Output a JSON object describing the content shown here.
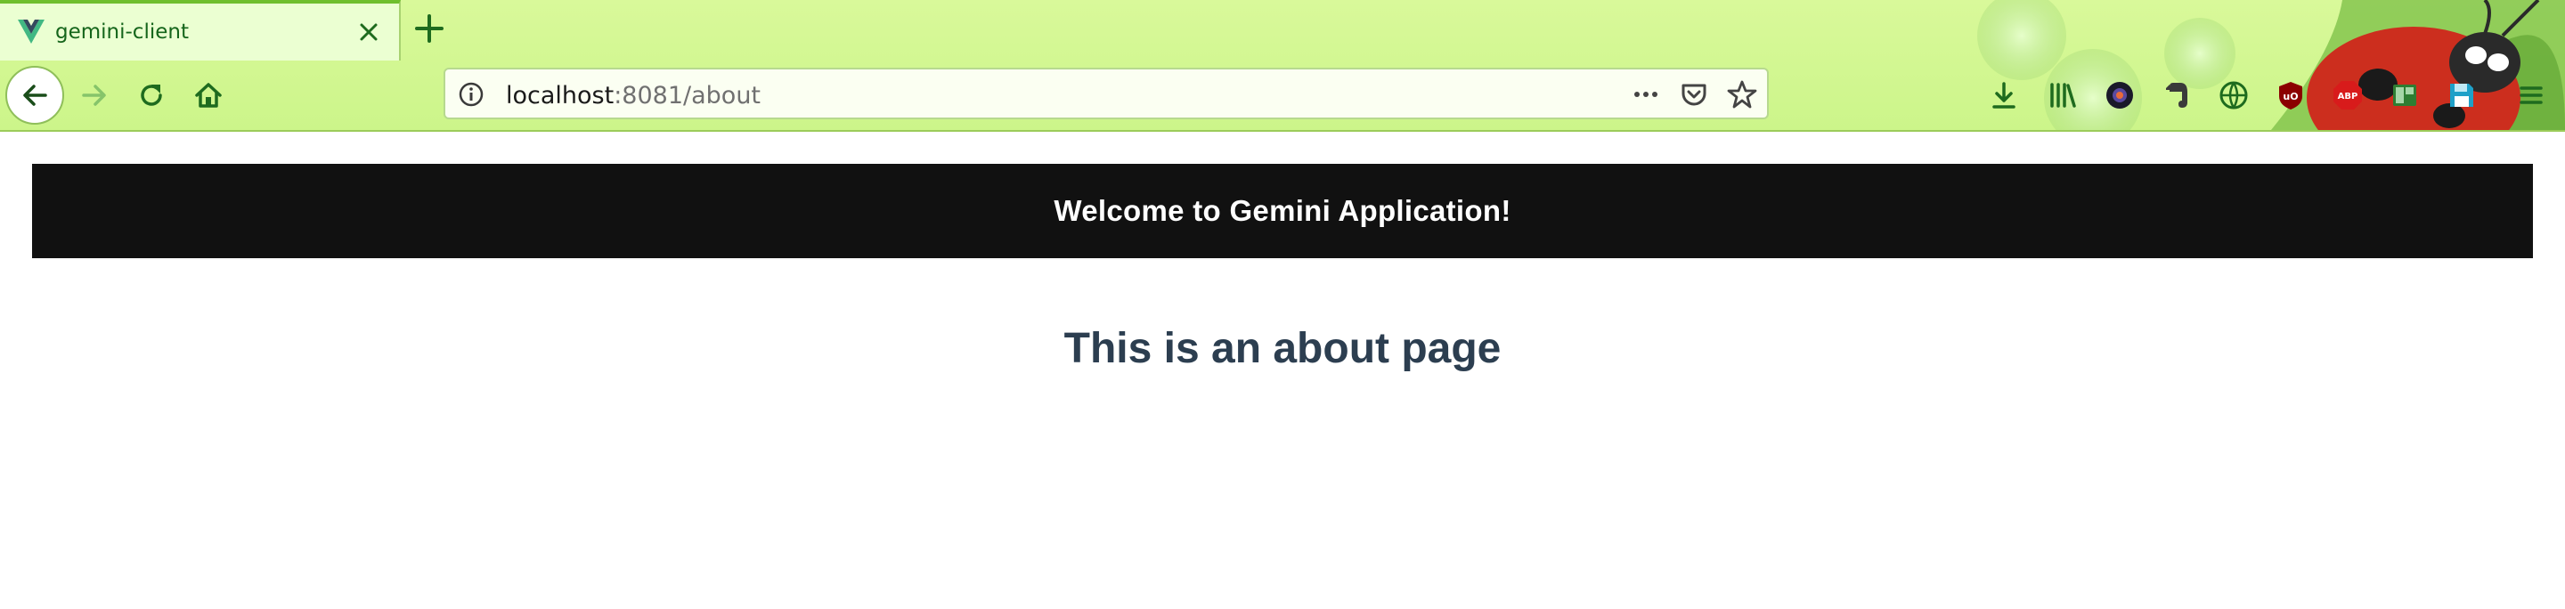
{
  "browser": {
    "tab": {
      "title": "gemini-client"
    },
    "url": {
      "host": "localhost",
      "rest": ":8081/about"
    },
    "colors": {
      "chrome": "#d9f99a",
      "icon": "#1e6b1e"
    }
  },
  "toolbar": {
    "icons": [
      "download-icon",
      "library-icon",
      "camera-extension-icon",
      "evernote-icon",
      "translate-icon",
      "ublock-icon",
      "adblock-plus-icon",
      "sidebar-extension-icon",
      "save-extension-icon",
      "menu-icon"
    ],
    "abp_label": "ABP",
    "ublock_label": "uO"
  },
  "page": {
    "banner": "Welcome to Gemini Application!",
    "heading": "This is an about page",
    "colors": {
      "banner_bg": "#111111",
      "heading": "#2c3e50"
    }
  }
}
